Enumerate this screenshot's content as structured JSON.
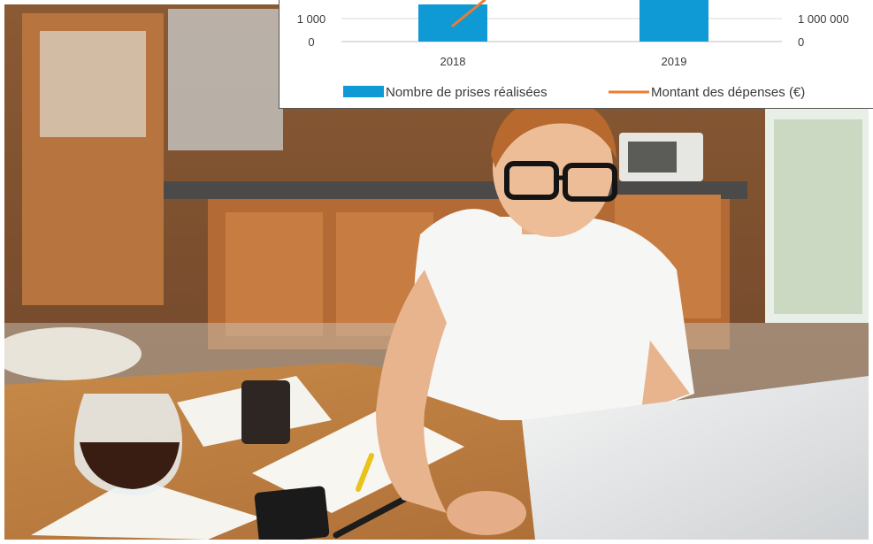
{
  "chart_data": {
    "type": "bar",
    "categories": [
      "2018",
      "2019"
    ],
    "series": [
      {
        "name": "Nombre de prises réalisées",
        "kind": "bar",
        "axis": "left",
        "color": "#0f9ad6"
      },
      {
        "name": "Montant des dépenses (€)",
        "kind": "line",
        "axis": "right",
        "color": "#ec7c30"
      }
    ],
    "left_axis_ticks": [
      "0",
      "1 000"
    ],
    "right_axis_ticks": [
      "0",
      "1 000 000"
    ],
    "grid": true,
    "legend_position": "bottom"
  },
  "colors": {
    "bar": "#0f9ad6",
    "line": "#ec7c30",
    "grid": "#d9d9d9",
    "text": "#3a3a3a"
  }
}
